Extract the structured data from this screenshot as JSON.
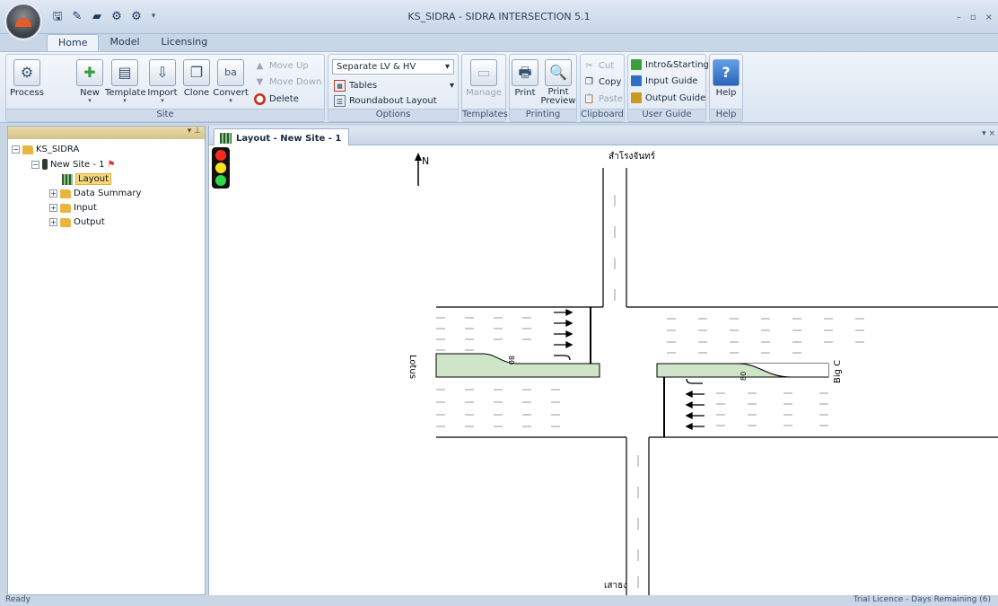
{
  "window": {
    "title": "KS_SIDRA - SIDRA INTERSECTION 5.1",
    "minimize": "–",
    "restore": "▫",
    "close": "×"
  },
  "tabs": [
    "Home",
    "Model",
    "Licensing"
  ],
  "ribbon": {
    "site": {
      "label": "Site",
      "process": "Process",
      "new": "New",
      "template": "Template",
      "import": "Import",
      "clone": "Clone",
      "convert": "Convert",
      "move_up": "Move Up",
      "move_down": "Move Down",
      "delete": "Delete"
    },
    "options": {
      "label": "Options",
      "combo_value": "Separate LV & HV",
      "tables": "Tables",
      "roundabout": "Roundabout Layout"
    },
    "templates": {
      "label": "Templates",
      "manage": "Manage"
    },
    "printing": {
      "label": "Printing",
      "print": "Print",
      "preview": "Print Preview"
    },
    "clipboard": {
      "label": "Clipboard",
      "cut": "Cut",
      "copy": "Copy",
      "paste": "Paste"
    },
    "user_guide": {
      "label": "User Guide",
      "intro": "Intro&Starting",
      "input": "Input Guide",
      "output": "Output Guide"
    },
    "help": {
      "label": "Help",
      "help": "Help"
    }
  },
  "tree": {
    "root": "KS_SIDRA",
    "site": "New Site - 1",
    "layout": "Layout",
    "data_summary": "Data Summary",
    "input": "Input",
    "output": "Output"
  },
  "document": {
    "tab": "Layout - New Site - 1",
    "north": "N",
    "approach_north": "สำโรงจันทร์",
    "approach_south": "เสาธง",
    "approach_west": "Lotus",
    "approach_east": "Big C",
    "lane_width_w": "80",
    "lane_width_e": "80"
  },
  "status": {
    "left": "Ready",
    "right": "Trial Licence - Days Remaining (6)"
  },
  "colors": {
    "median": "#cfe5c7",
    "ribbon": "#dae5f1",
    "signal_red": "#ff2a1f",
    "signal_yellow": "#ffe21f",
    "signal_green": "#2dd84b"
  }
}
